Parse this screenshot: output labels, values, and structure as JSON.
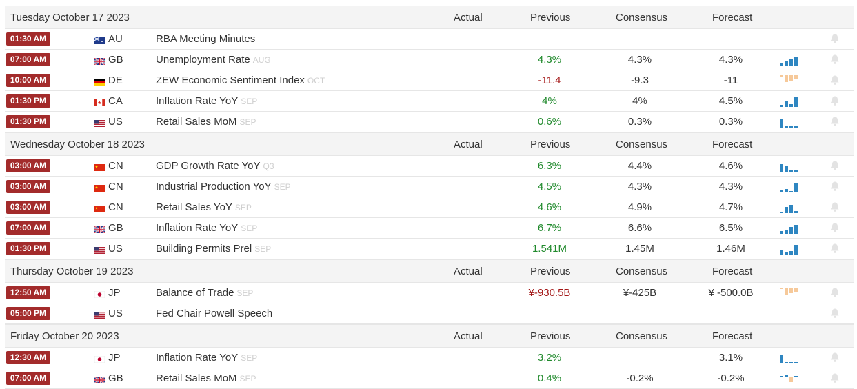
{
  "columns": {
    "actual": "Actual",
    "previous": "Previous",
    "consensus": "Consensus",
    "forecast": "Forecast"
  },
  "colors": {
    "badge": "#a32b2b",
    "positive": "#218a2d",
    "negative": "#a31515",
    "spark_blue": "#2e86c1",
    "spark_orange": "#f6c99a"
  },
  "days": [
    {
      "title": "Tuesday October 17 2023",
      "events": [
        {
          "time": "01:30 AM",
          "flag": "au",
          "country": "AU",
          "name": "RBA Meeting Minutes",
          "ref": "",
          "previous": "",
          "prev_tone": "neu",
          "consensus": "",
          "forecast": "",
          "spark": ""
        },
        {
          "time": "07:00 AM",
          "flag": "gb",
          "country": "GB",
          "name": "Unemployment Rate",
          "ref": "AUG",
          "previous": "4.3%",
          "prev_tone": "pos",
          "consensus": "4.3%",
          "forecast": "4.3%",
          "spark": "blue"
        },
        {
          "time": "10:00 AM",
          "flag": "de",
          "country": "DE",
          "name": "ZEW Economic Sentiment Index",
          "ref": "OCT",
          "previous": "-11.4",
          "prev_tone": "neg",
          "consensus": "-9.3",
          "forecast": "-11",
          "spark": "orange"
        },
        {
          "time": "01:30 PM",
          "flag": "ca",
          "country": "CA",
          "name": "Inflation Rate YoY",
          "ref": "SEP",
          "previous": "4%",
          "prev_tone": "pos",
          "consensus": "4%",
          "forecast": "4.5%",
          "spark": "blue"
        },
        {
          "time": "01:30 PM",
          "flag": "us",
          "country": "US",
          "name": "Retail Sales MoM",
          "ref": "SEP",
          "previous": "0.6%",
          "prev_tone": "pos",
          "consensus": "0.3%",
          "forecast": "0.3%",
          "spark": "blue"
        }
      ]
    },
    {
      "title": "Wednesday October 18 2023",
      "events": [
        {
          "time": "03:00 AM",
          "flag": "cn",
          "country": "CN",
          "name": "GDP Growth Rate YoY",
          "ref": "Q3",
          "previous": "6.3%",
          "prev_tone": "pos",
          "consensus": "4.4%",
          "forecast": "4.6%",
          "spark": "blue"
        },
        {
          "time": "03:00 AM",
          "flag": "cn",
          "country": "CN",
          "name": "Industrial Production YoY",
          "ref": "SEP",
          "previous": "4.5%",
          "prev_tone": "pos",
          "consensus": "4.3%",
          "forecast": "4.3%",
          "spark": "blue"
        },
        {
          "time": "03:00 AM",
          "flag": "cn",
          "country": "CN",
          "name": "Retail Sales YoY",
          "ref": "SEP",
          "previous": "4.6%",
          "prev_tone": "pos",
          "consensus": "4.9%",
          "forecast": "4.7%",
          "spark": "blue"
        },
        {
          "time": "07:00 AM",
          "flag": "gb",
          "country": "GB",
          "name": "Inflation Rate YoY",
          "ref": "SEP",
          "previous": "6.7%",
          "prev_tone": "pos",
          "consensus": "6.6%",
          "forecast": "6.5%",
          "spark": "blue"
        },
        {
          "time": "01:30 PM",
          "flag": "us",
          "country": "US",
          "name": "Building Permits Prel",
          "ref": "SEP",
          "previous": "1.541M",
          "prev_tone": "pos",
          "consensus": "1.45M",
          "forecast": "1.46M",
          "spark": "blue"
        }
      ]
    },
    {
      "title": "Thursday October 19 2023",
      "events": [
        {
          "time": "12:50 AM",
          "flag": "jp",
          "country": "JP",
          "name": "Balance of Trade",
          "ref": "SEP",
          "previous": "¥-930.5B",
          "prev_tone": "neg",
          "consensus": "¥-425B",
          "forecast": "¥ -500.0B",
          "spark": "orange"
        },
        {
          "time": "05:00 PM",
          "flag": "us",
          "country": "US",
          "name": "Fed Chair Powell Speech",
          "ref": "",
          "previous": "",
          "prev_tone": "neu",
          "consensus": "",
          "forecast": "",
          "spark": ""
        }
      ]
    },
    {
      "title": "Friday October 20 2023",
      "events": [
        {
          "time": "12:30 AM",
          "flag": "jp",
          "country": "JP",
          "name": "Inflation Rate YoY",
          "ref": "SEP",
          "previous": "3.2%",
          "prev_tone": "pos",
          "consensus": "",
          "forecast": "3.1%",
          "spark": "blue"
        },
        {
          "time": "07:00 AM",
          "flag": "gb",
          "country": "GB",
          "name": "Retail Sales MoM",
          "ref": "SEP",
          "previous": "0.4%",
          "prev_tone": "pos",
          "consensus": "-0.2%",
          "forecast": "-0.2%",
          "spark": "mixed"
        }
      ]
    }
  ]
}
